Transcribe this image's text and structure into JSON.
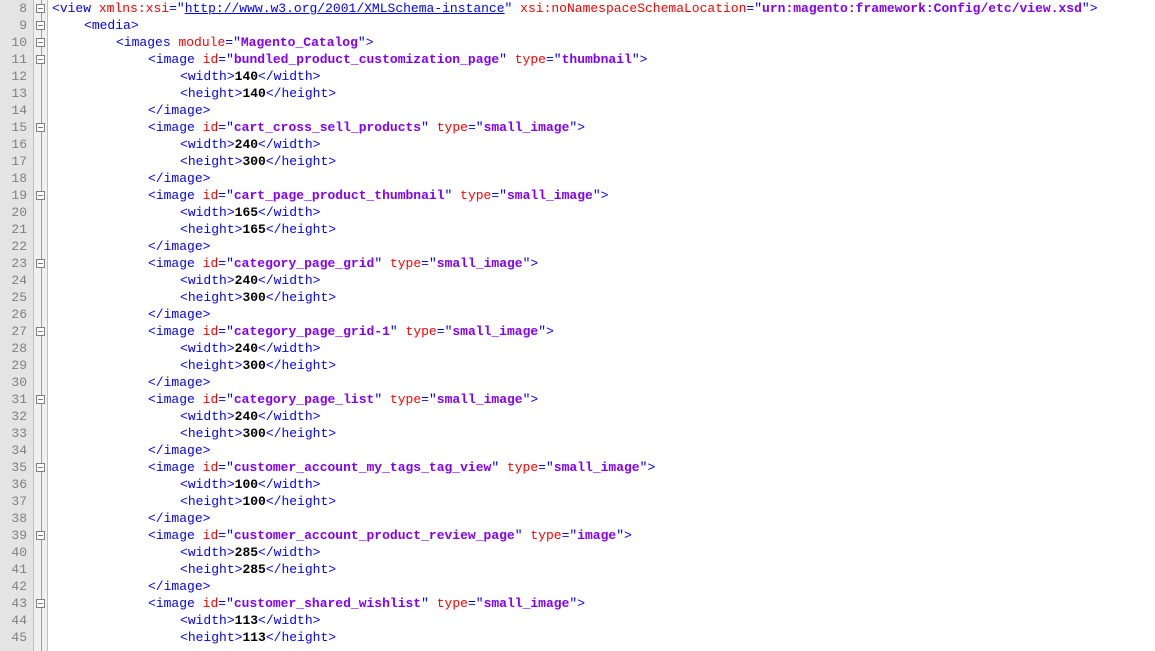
{
  "startLine": 8,
  "view": {
    "xmlns_xsi_attr": "xmlns:xsi",
    "xmlns_xsi_url": "http://www.w3.org/2001/XMLSchema-instance",
    "nons_attr": "xsi:noNamespaceSchemaLocation",
    "nons_val": "urn:magento:framework:Config/etc/view.xsd"
  },
  "media_tag": "media",
  "images_tag": "images",
  "images_module_attr": "module",
  "images_module_val": "Magento_Catalog",
  "image_tag": "image",
  "id_attr": "id",
  "type_attr": "type",
  "width_tag": "width",
  "height_tag": "height",
  "close_image": "image",
  "images": [
    {
      "id": "bundled_product_customization_page",
      "type": "thumbnail",
      "w": "140",
      "h": "140"
    },
    {
      "id": "cart_cross_sell_products",
      "type": "small_image",
      "w": "240",
      "h": "300"
    },
    {
      "id": "cart_page_product_thumbnail",
      "type": "small_image",
      "w": "165",
      "h": "165"
    },
    {
      "id": "category_page_grid",
      "type": "small_image",
      "w": "240",
      "h": "300"
    },
    {
      "id": "category_page_grid-1",
      "type": "small_image",
      "w": "240",
      "h": "300"
    },
    {
      "id": "category_page_list",
      "type": "small_image",
      "w": "240",
      "h": "300"
    },
    {
      "id": "customer_account_my_tags_tag_view",
      "type": "small_image",
      "w": "100",
      "h": "100"
    },
    {
      "id": "customer_account_product_review_page",
      "type": "image",
      "w": "285",
      "h": "285"
    },
    {
      "id": "customer_shared_wishlist",
      "type": "small_image",
      "w": "113",
      "h": "113"
    }
  ]
}
